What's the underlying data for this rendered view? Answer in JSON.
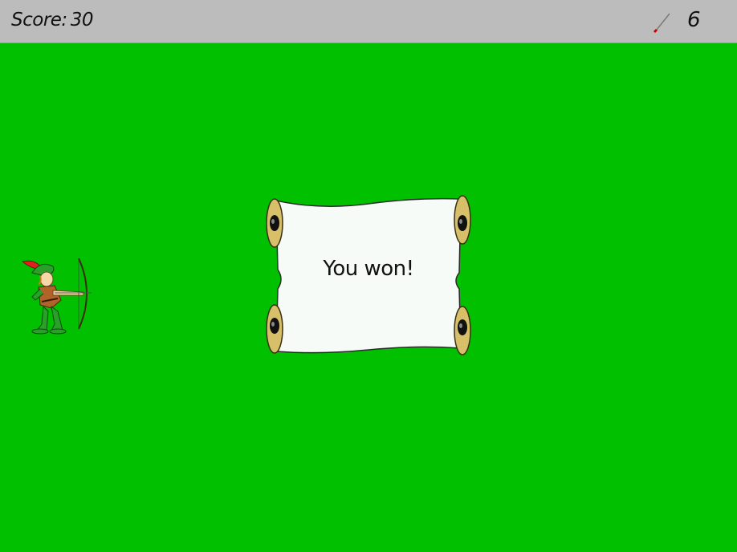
{
  "hud": {
    "score_label": "Score:",
    "score_value": "30",
    "arrows_remaining": "6",
    "arrow_icon": "arrow-icon"
  },
  "message": {
    "text": "You won!"
  },
  "colors": {
    "field": "#00c000",
    "topbar": "#bcbcbc",
    "scroll_paper": "#f6fbf8",
    "scroll_roll": "#d8c06a"
  }
}
